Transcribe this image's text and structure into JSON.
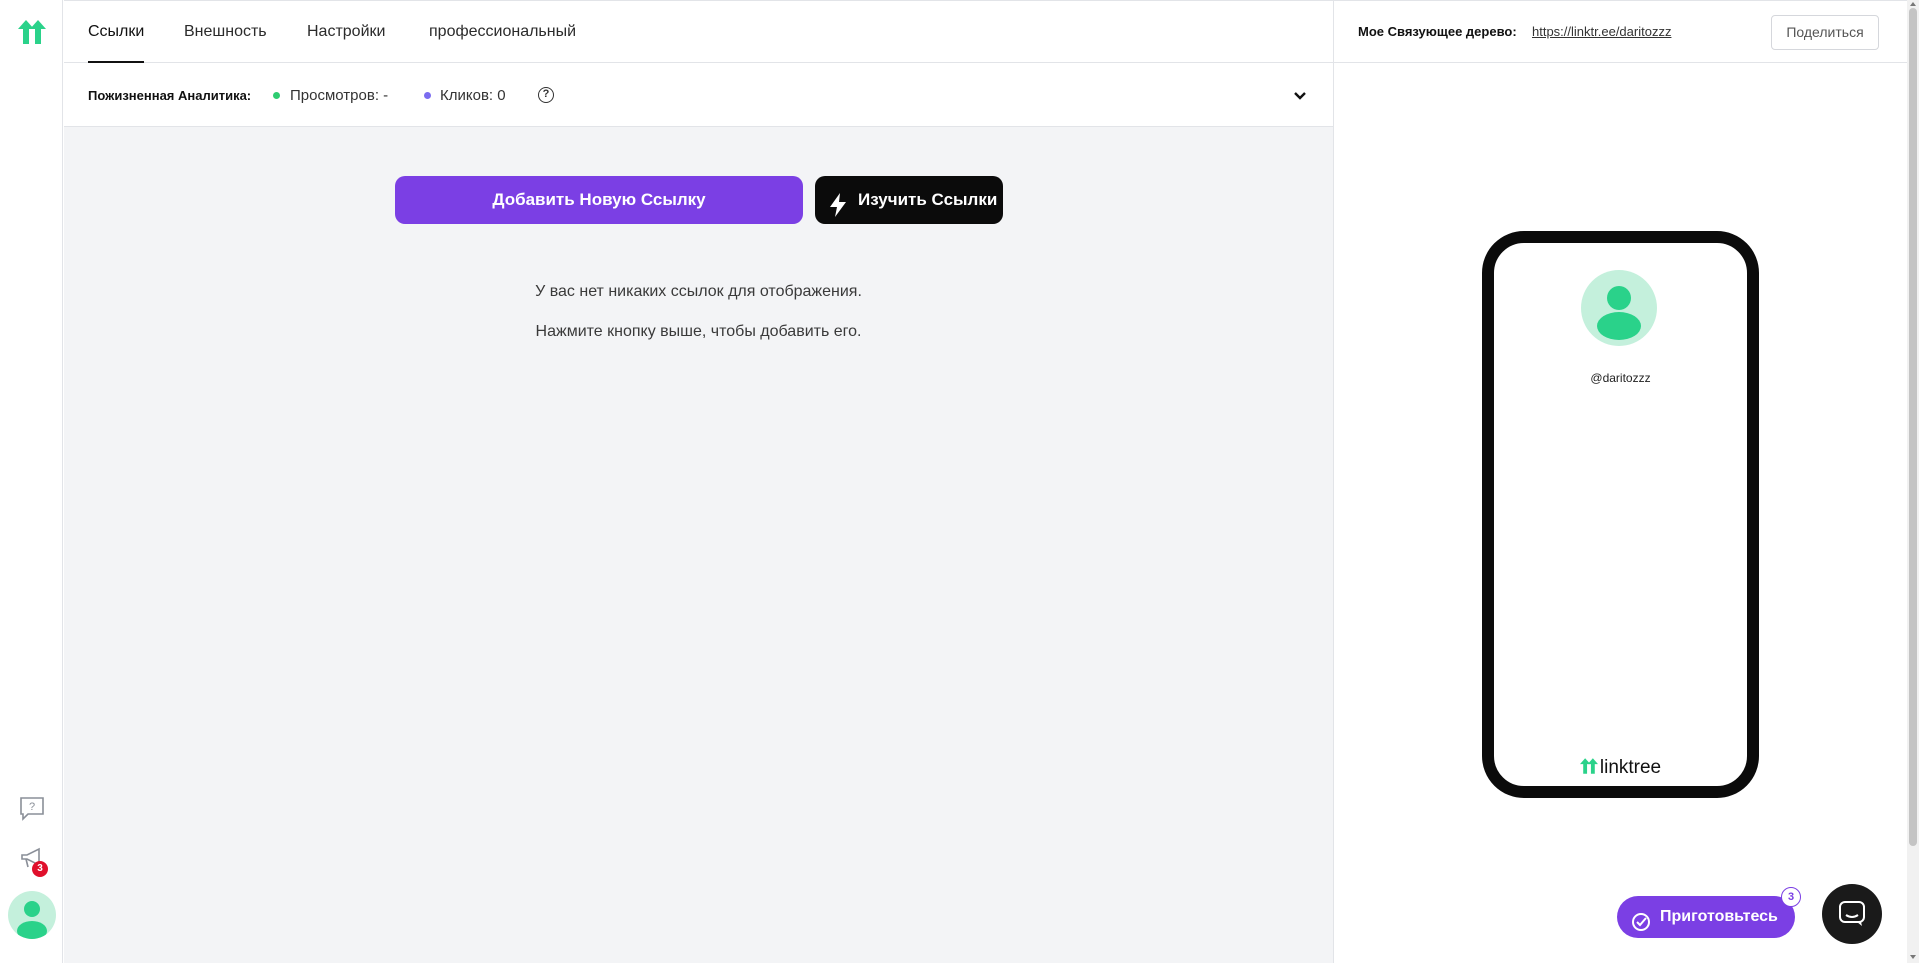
{
  "nav": {
    "tabs": [
      {
        "label": "Ссылки",
        "active": true
      },
      {
        "label": "Внешность",
        "active": false
      },
      {
        "label": "Настройки",
        "active": false
      },
      {
        "label": "профессиональный",
        "active": false
      }
    ]
  },
  "analytics": {
    "title": "Пожизненная Аналитика:",
    "views": "Просмотров: -",
    "clicks": "Кликов: 0",
    "views_color": "#2ecc71",
    "clicks_color": "#7b6cf0"
  },
  "actions": {
    "add_link": "Добавить Новую Ссылку",
    "explore_links": "Изучить Ссылки"
  },
  "empty": {
    "line1": "У вас нет никаких ссылок для отображения.",
    "line2": "Нажмите кнопку выше, чтобы добавить его."
  },
  "preview": {
    "tree_label": "Мое Связующее дерево:",
    "tree_url": "https://linktr.ee/daritozzz",
    "share": "Поделиться",
    "handle": "@daritozzz",
    "brand": "linktree"
  },
  "sidebar": {
    "notifications_count": "3"
  },
  "widgets": {
    "get_ready": "Приготовьтесь",
    "get_ready_count": "3"
  },
  "colors": {
    "accent": "#7b3fe4",
    "brand_green": "#43e660",
    "avatar_bg": "#c4f0dc",
    "avatar_fg": "#2ad28a"
  }
}
